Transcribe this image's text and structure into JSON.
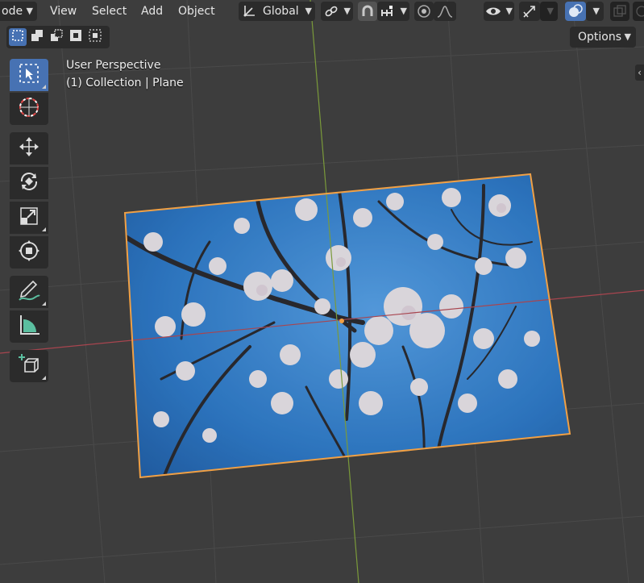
{
  "header": {
    "mode_partial": "ode",
    "menu": [
      "View",
      "Select",
      "Add",
      "Object"
    ],
    "transform_orientation": "Global"
  },
  "overlay": {
    "view_name": "User Perspective",
    "collection_prefix": "(1) Collection",
    "object_name": "Plane"
  },
  "options_label": "Options",
  "icons": {
    "orientation": "transform-axes-icon",
    "pivot": "link-icon",
    "snap": "magnet-icon",
    "snap_target": "snap-increment-icon",
    "proportional": "proportional-edit-icon",
    "falloff": "falloff-curve-icon",
    "visibility": "eye-icon",
    "gizmo": "gizmo-icon",
    "overlays": "overlays-icon",
    "xray": "xray-icon"
  },
  "tools": [
    "select-box-icon",
    "cursor-icon",
    "move-icon",
    "rotate-icon",
    "scale-icon",
    "transform-icon",
    "annotate-icon",
    "measure-icon",
    "add-cube-icon"
  ],
  "colors": {
    "viewport_bg": "#3d3d3d",
    "grid": "#4a4a4a",
    "x_axis": "#a8454f",
    "y_axis": "#7a9a3a",
    "selection_outline": "#f0a045",
    "active_blue": "#4772b3",
    "sky": "#2f7fd0"
  }
}
